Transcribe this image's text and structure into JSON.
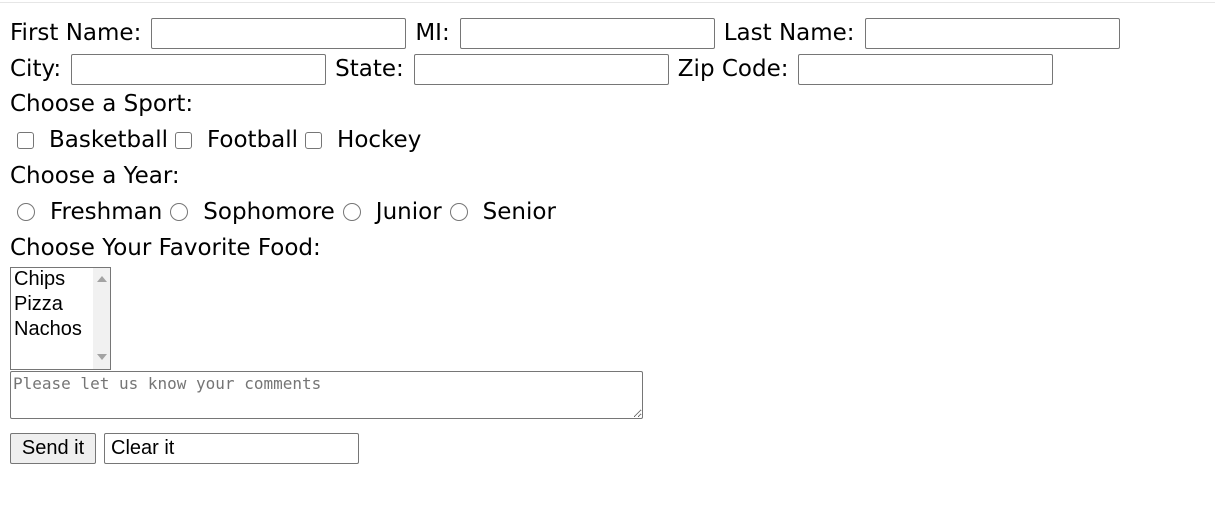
{
  "name_row": {
    "first_name_label": "First Name:",
    "first_name_value": "",
    "mi_label": "MI:",
    "mi_value": "",
    "last_name_label": "Last Name:",
    "last_name_value": ""
  },
  "address_row": {
    "city_label": "City:",
    "city_value": "",
    "state_label": "State:",
    "state_value": "",
    "zip_label": "Zip Code:",
    "zip_value": ""
  },
  "sport": {
    "heading": "Choose a Sport:",
    "options": [
      "Basketball",
      "Football",
      "Hockey"
    ]
  },
  "year": {
    "heading": "Choose a Year:",
    "options": [
      "Freshman",
      "Sophomore",
      "Junior",
      "Senior"
    ]
  },
  "food": {
    "heading": "Choose Your Favorite Food:",
    "options": [
      "Chips",
      "Pizza",
      "Nachos"
    ]
  },
  "comments": {
    "placeholder": "Please let us know your comments",
    "value": ""
  },
  "actions": {
    "send_label": "Send it",
    "clear_label": "Clear it"
  },
  "icons": {
    "scroll_up": "chevron-up-icon",
    "scroll_down": "chevron-down-icon",
    "resize": "resize-grip-icon"
  }
}
